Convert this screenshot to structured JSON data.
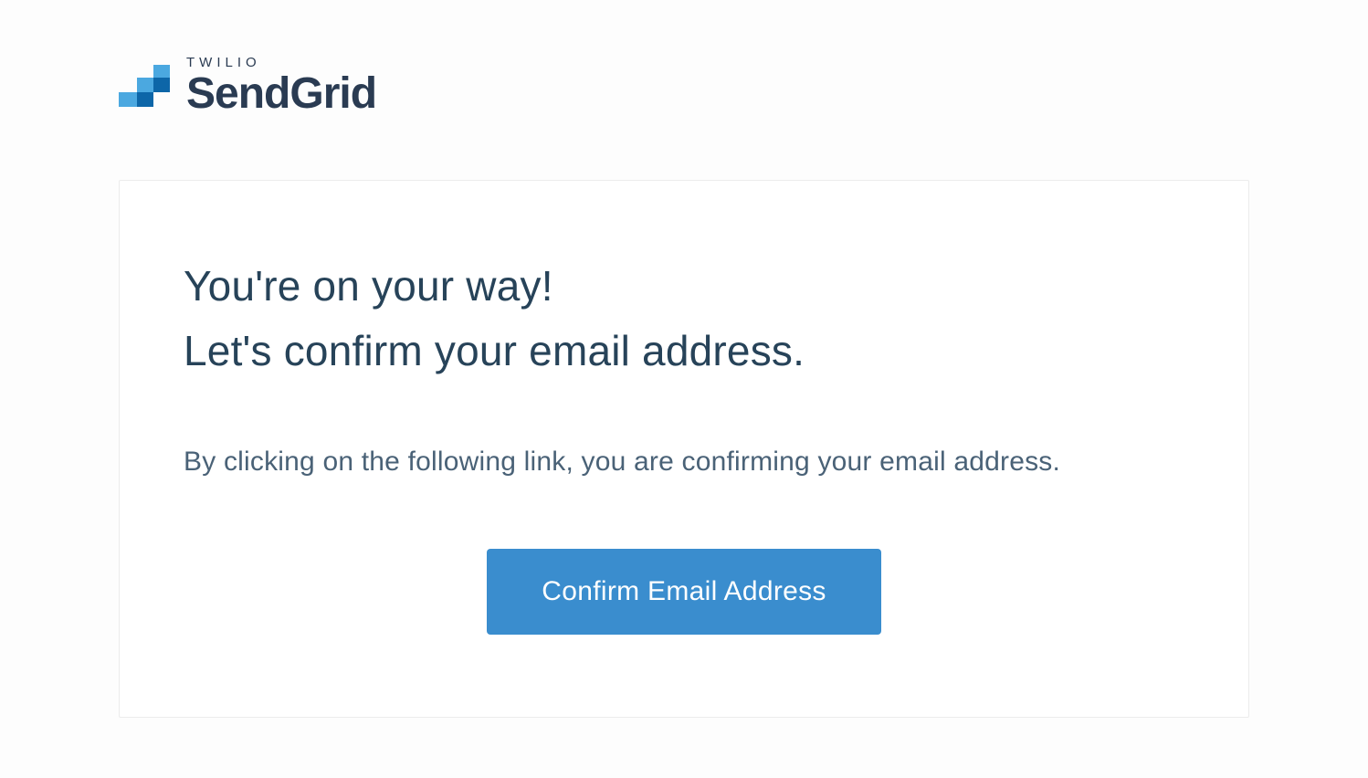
{
  "logo": {
    "overline": "TWILIO",
    "brand": "SendGrid"
  },
  "card": {
    "heading_line1": "You're on your way!",
    "heading_line2": "Let's confirm your email address.",
    "body": "By clicking on the following link, you are confirming your email address.",
    "button_label": "Confirm Email Address"
  },
  "colors": {
    "primary_button": "#3a8dce",
    "text_dark": "#274359",
    "text_body": "#4a6277"
  }
}
